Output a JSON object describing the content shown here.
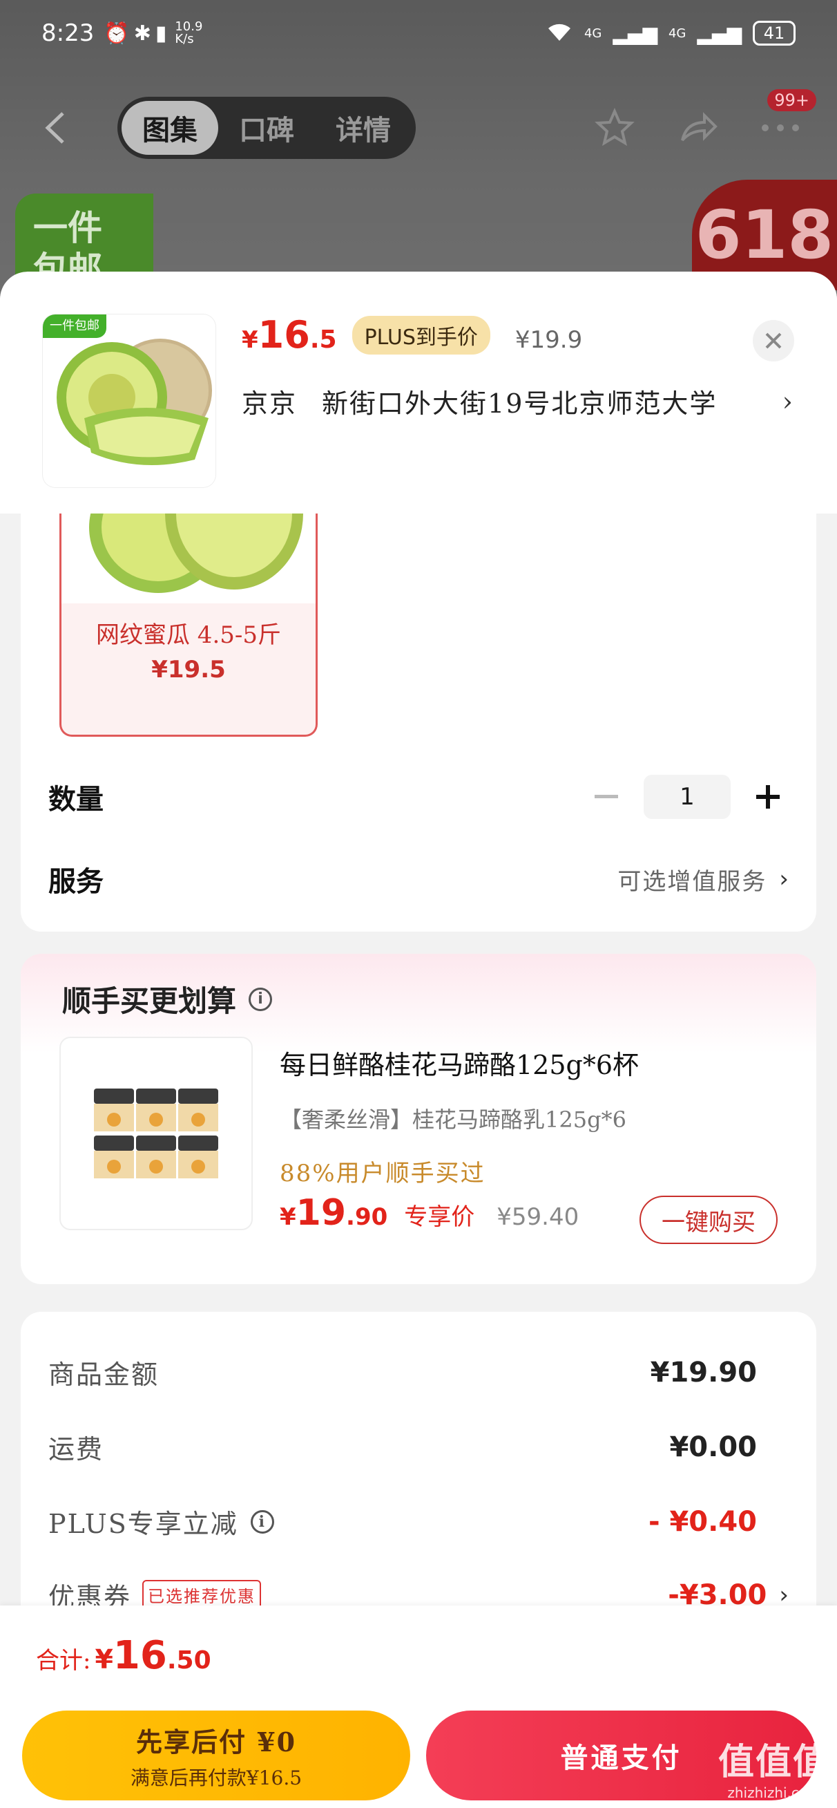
{
  "status_bar": {
    "time": "8:23",
    "net_speed_value": "10.9",
    "net_speed_unit": "K/s",
    "signal_1": "4G",
    "signal_2": "4G",
    "battery": "41"
  },
  "nav": {
    "tabs": [
      {
        "label": "图集",
        "active": true
      },
      {
        "label": "口碑",
        "active": false
      },
      {
        "label": "详情",
        "active": false
      }
    ],
    "more_badge": "99+"
  },
  "background_promo": {
    "left_tag": "一件包邮",
    "right_tag": "618"
  },
  "product": {
    "thumb_tag": "一件包邮",
    "price_symbol": "¥",
    "price_int": "16",
    "price_dec": ".5",
    "plus_label": "PLUS到手价",
    "orig_price": "¥19.9",
    "addr_city": "京京",
    "addr_detail": "新街口外大街19号北京师范大学"
  },
  "spec": {
    "name": "网纹蜜瓜  4.5-5斤",
    "price": "¥19.5"
  },
  "quantity": {
    "label": "数量",
    "value": "1"
  },
  "service": {
    "label": "服务",
    "value": "可选增值服务"
  },
  "bundle": {
    "title": "顺手买更划算",
    "name": "每日鲜酪桂花马蹄酪125g*6杯",
    "desc": "【奢柔丝滑】桂花马蹄酪乳125g*6",
    "stat": "88%用户顺手买过",
    "price_symbol": "¥",
    "price_int": "19",
    "price_dec": ".90",
    "exclusive": "专享价",
    "orig_price": "¥59.40",
    "buy_label": "一键购买"
  },
  "fees": [
    {
      "label": "商品金额",
      "value": "¥19.90",
      "red": false
    },
    {
      "label": "运费",
      "value": "¥0.00",
      "red": false
    },
    {
      "label": "PLUS专享立减",
      "value": "- ¥0.40",
      "red": true
    },
    {
      "label": "优惠券",
      "tag": "已选推荐优惠",
      "value": "-¥3.00",
      "red": true
    }
  ],
  "bottom": {
    "total_label": "合计:",
    "total_symbol": "¥",
    "total_int": "16",
    "total_dec": ".50",
    "pay_later_l1": "先享后付 ¥0",
    "pay_later_l2": "满意后再付款¥16.5",
    "pay_normal": "普通支付"
  },
  "watermark": {
    "line1": "值值值",
    "line2": "zhizhizhi.com"
  },
  "colors": {
    "accent_red": "#e2231a",
    "pay_yellow": "#ffc107",
    "pay_red": "#e8233e",
    "plus_gold": "#f7e1a8"
  }
}
